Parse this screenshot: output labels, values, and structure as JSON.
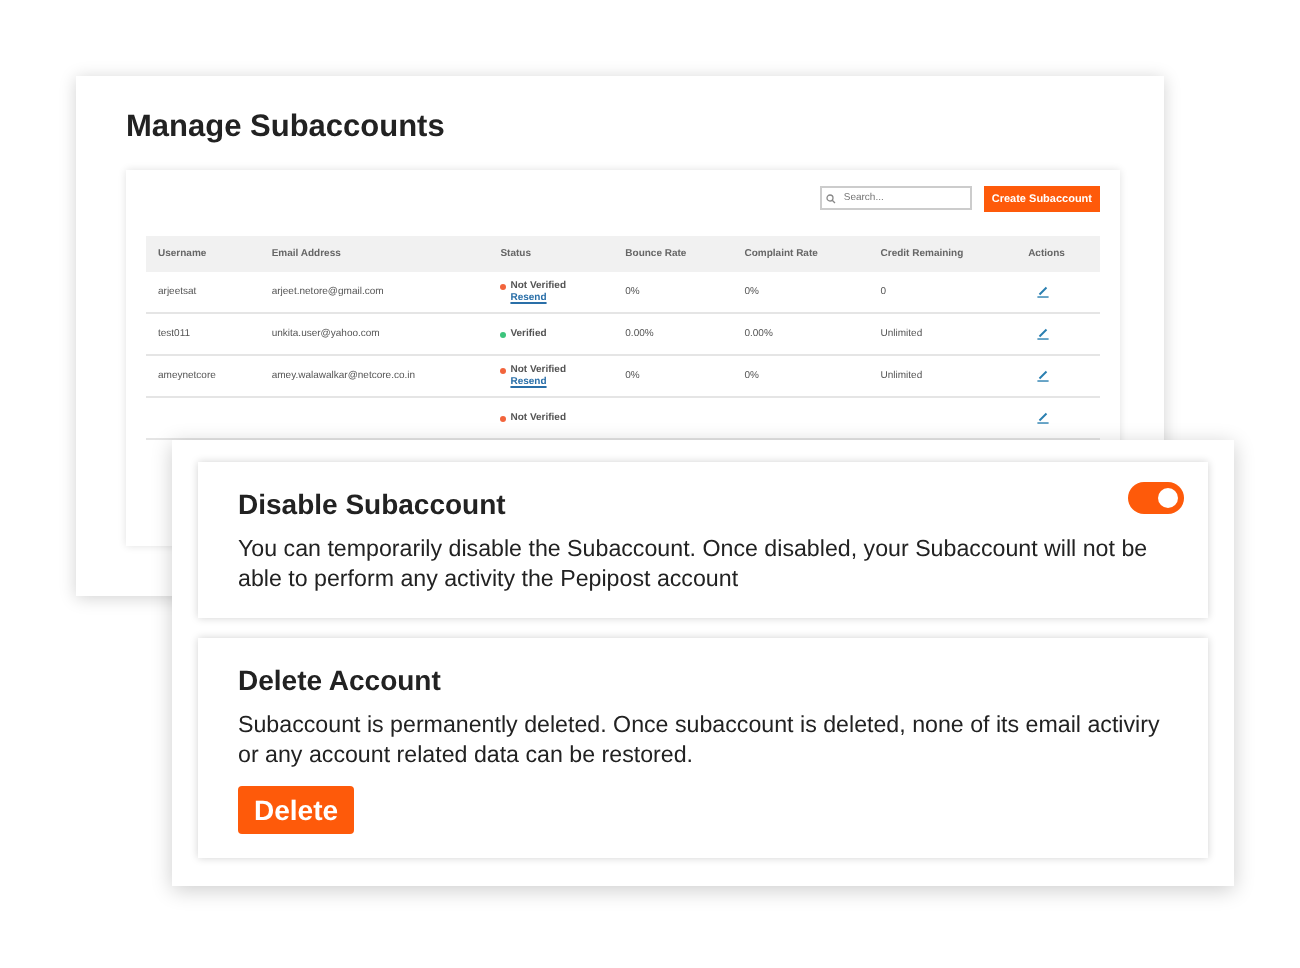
{
  "page": {
    "title": "Manage Subaccounts"
  },
  "toolbar": {
    "search": {
      "placeholder": "Search..."
    },
    "create_button": "Create Subaccount"
  },
  "table": {
    "columns": [
      "Username",
      "Email Address",
      "Status",
      "Bounce Rate",
      "Complaint Rate",
      "Credit Remaining",
      "Actions"
    ],
    "rows": [
      {
        "username": "arjeetsat",
        "email": "arjeet.netore@gmail.com",
        "status": "Not Verified",
        "color": "#f2643c",
        "resend": "Resend",
        "bounce_rate": "0%",
        "complaint_rate": "0%",
        "credit": "0"
      },
      {
        "username": "test011",
        "email": "unkita.user@yahoo.com",
        "status": "Verified",
        "color": "#3cc47c",
        "bounce_rate": "0.00%",
        "complaint_rate": "0.00%",
        "credit": "Unlimited"
      },
      {
        "username": "ameynetcore",
        "email": "amey.walawalkar@netcore.co.in",
        "status": "Not Verified",
        "color": "#f2643c",
        "resend": "Resend",
        "bounce_rate": "0%",
        "complaint_rate": "0%",
        "credit": "Unlimited"
      },
      {
        "status": "Not Verified",
        "color": "#f2643c"
      }
    ]
  },
  "settings": {
    "disable": {
      "title": "Disable Subaccount",
      "on": true,
      "description": "You can temporarily disable the Subaccount. Once disabled, your Subaccount will not be able to perform any activity the Pepipost account"
    },
    "delete": {
      "title": "Delete Account",
      "description": "Subaccount is permanently deleted. Once subaccount is deleted, none of its email activiry or any account related data can be restored.",
      "button": "Delete"
    }
  }
}
